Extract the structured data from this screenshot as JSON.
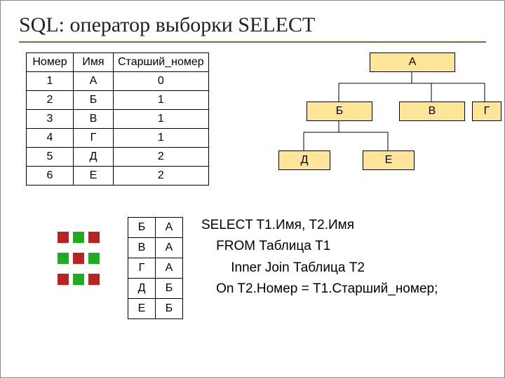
{
  "title": "SQL: оператор выборки SELECT",
  "table1": {
    "headers": {
      "c1": "Номер",
      "c2": "Имя",
      "c3": "Старший_номер"
    },
    "rows": [
      {
        "c1": "1",
        "c2": "А",
        "c3": "0"
      },
      {
        "c1": "2",
        "c2": "Б",
        "c3": "1"
      },
      {
        "c1": "3",
        "c2": "В",
        "c3": "1"
      },
      {
        "c1": "4",
        "c2": "Г",
        "c3": "1"
      },
      {
        "c1": "5",
        "c2": "Д",
        "c3": "2"
      },
      {
        "c1": "6",
        "c2": "Е",
        "c3": "2"
      }
    ]
  },
  "table2": {
    "rows": [
      {
        "c1": "Б",
        "c2": "А"
      },
      {
        "c1": "В",
        "c2": "А"
      },
      {
        "c1": "Г",
        "c2": "А"
      },
      {
        "c1": "Д",
        "c2": "Б"
      },
      {
        "c1": "Е",
        "c2": "Б"
      }
    ]
  },
  "tree": {
    "a": "А",
    "b": "Б",
    "v": "В",
    "g": "Г",
    "d": "Д",
    "e": "Е"
  },
  "sql": {
    "l1": "SELECT T1.Имя, T2.Имя",
    "l2": "    FROM Таблица T1",
    "l3": "        Inner Join Таблица T2",
    "l4": "    On T2.Номер = T1.Старший_номер;"
  }
}
